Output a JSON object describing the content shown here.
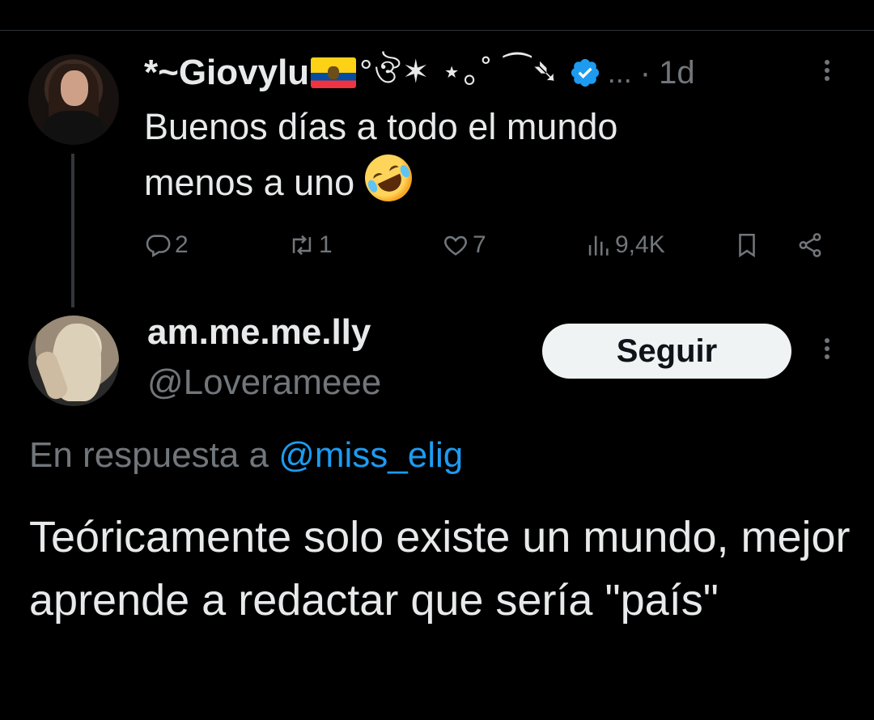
{
  "tweet1": {
    "display_name": "*~Giovylu",
    "name_decoration": "°ঔ✶ ⋆｡˚ ⁀➴",
    "flag_icon": "ecuador-flag",
    "verified_icon": "verified-badge",
    "ellipsis": "...",
    "separator": "·",
    "time": "1d",
    "text_line1": "Buenos días a todo el mundo",
    "text_line2": "menos a uno",
    "emoji_icon": "rolling-on-floor-laughing",
    "replies": "2",
    "retweets": "1",
    "likes": "7",
    "views": "9,4K"
  },
  "tweet2": {
    "display_name": "am.me.me.lly",
    "handle": "@Loverameee",
    "follow_label": "Seguir",
    "replying_prefix": "En respuesta a",
    "replying_to": "@miss_elig",
    "text": "Teóricamente solo existe un mundo, mejor aprende a redactar que sería \"país\""
  },
  "colors": {
    "background": "#000000",
    "text": "#e7e9ea",
    "muted": "#71767b",
    "accent": "#1d9bf0",
    "follow_bg": "#eff3f4"
  }
}
